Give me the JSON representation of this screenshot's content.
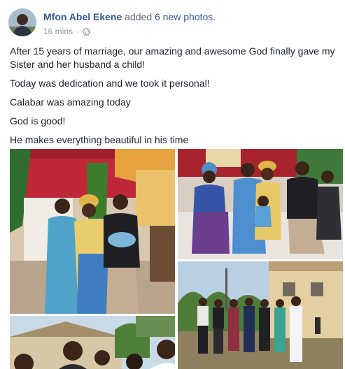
{
  "post": {
    "author": "Mfon Abel Ekene",
    "action": "added",
    "photo_count_text": "6 new photos.",
    "timestamp": "16 mins",
    "separator": "·",
    "privacy_icon": "globe-icon"
  },
  "body": {
    "paragraphs": [
      "After 15 years of marriage, our amazing and awesome God finally gave my Sister and her husband a child!",
      "Today was dedication and we took it personal!",
      "Calabar was amazing today",
      "God is good!",
      "He makes everything beautiful in his time"
    ]
  },
  "photos": [
    {
      "subject": "family-with-baby-indoor"
    },
    {
      "subject": "family-seated-on-sofa"
    },
    {
      "subject": "group-outdoor"
    },
    {
      "subject": "group-selfie"
    }
  ],
  "colors": {
    "link": "#365899",
    "text": "#1d2129",
    "meta": "#90949c"
  }
}
